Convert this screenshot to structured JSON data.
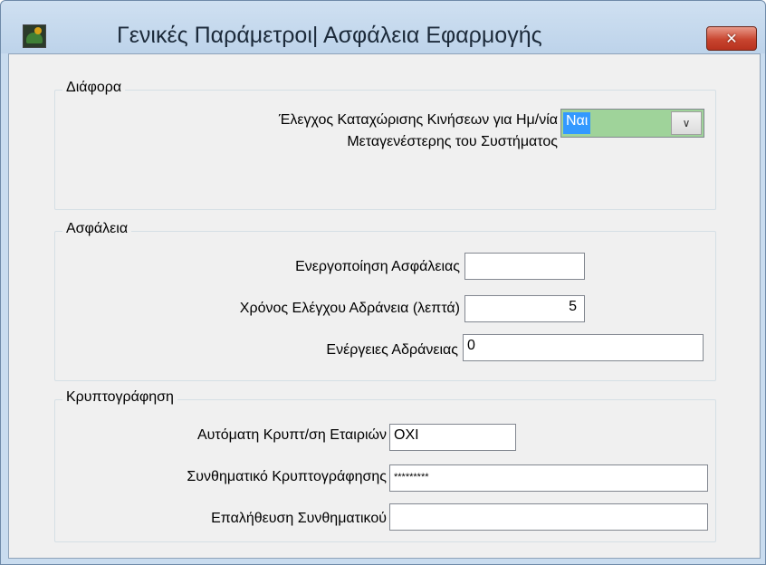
{
  "window": {
    "title": "Γενικές Παράμετροι| Ασφάλεια Εφαρμογής",
    "close_symbol": "✕"
  },
  "colors": {
    "title_bar": "#c9dcef",
    "close_button": "#c8452f",
    "combo_background": "#9fd39a",
    "selection": "#3399ff"
  },
  "sections": {
    "misc": {
      "title": "Διάφορα",
      "future_date_check": {
        "label_line1": "Έλεγχος Καταχώρισης Κινήσεων για Ημ/νία",
        "label_line2": "Μεταγενέστερης του Συστήματος",
        "value": "Ναι",
        "arrow_icon": "chevron-down-icon"
      }
    },
    "security": {
      "title": "Ασφάλεια",
      "activation": {
        "label": "Ενεργοποίηση Ασφάλειας",
        "value": ""
      },
      "idle_time": {
        "label": "Χρόνος Ελέγχου Αδράνεια (λεπτά)",
        "value": "5"
      },
      "idle_actions": {
        "label": "Ενέργειες Αδράνειας",
        "value": "0"
      }
    },
    "encryption": {
      "title": "Κρυπτογράφηση",
      "auto_encrypt": {
        "label": "Αυτόματη Κρυπτ/ση Εταιριών",
        "value": "ΟΧΙ"
      },
      "password": {
        "label": "Συνθηματικό Κρυπτογράφησης",
        "value": "*********"
      },
      "password_confirm": {
        "label": "Επαλήθευση Συνθηματικού",
        "value": ""
      }
    }
  }
}
